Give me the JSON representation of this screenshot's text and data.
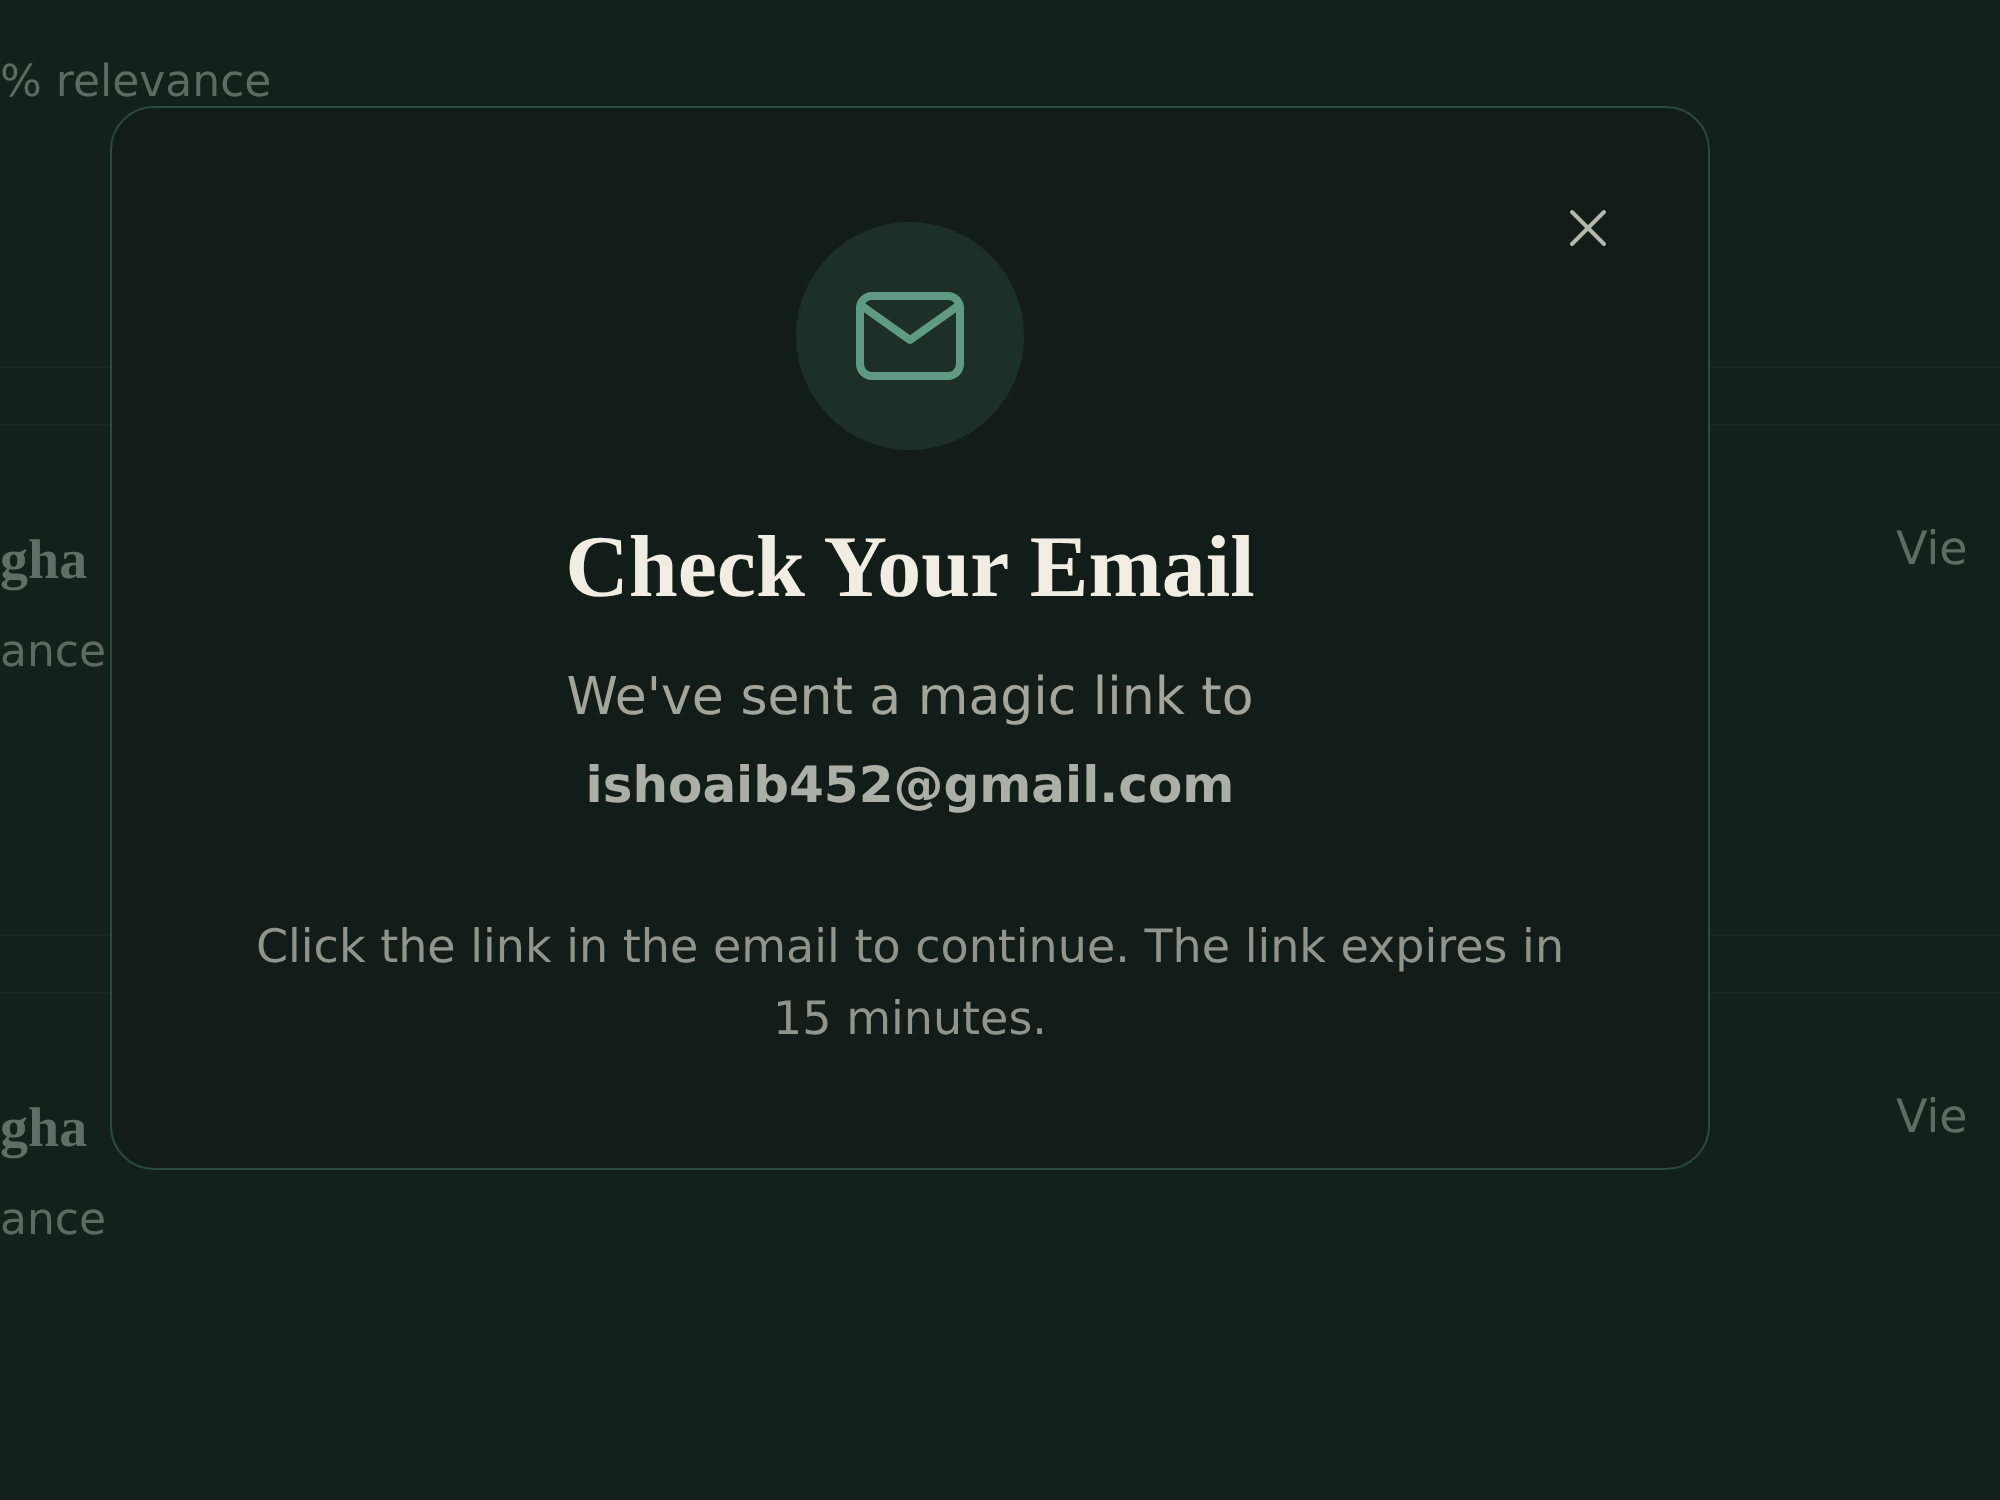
{
  "results": [
    {
      "relevance": "% relevance"
    },
    {
      "title": "gha",
      "relevance": "ance",
      "action": "Vie"
    },
    {
      "title": "gha",
      "relevance": "ance",
      "action": "Vie"
    }
  ],
  "modal": {
    "title": "Check Your Email",
    "message": "We've sent a magic link to **ishoaib452@gmail.com**",
    "note": "Click the link in the email to continue. The link expires in 15 minutes."
  }
}
